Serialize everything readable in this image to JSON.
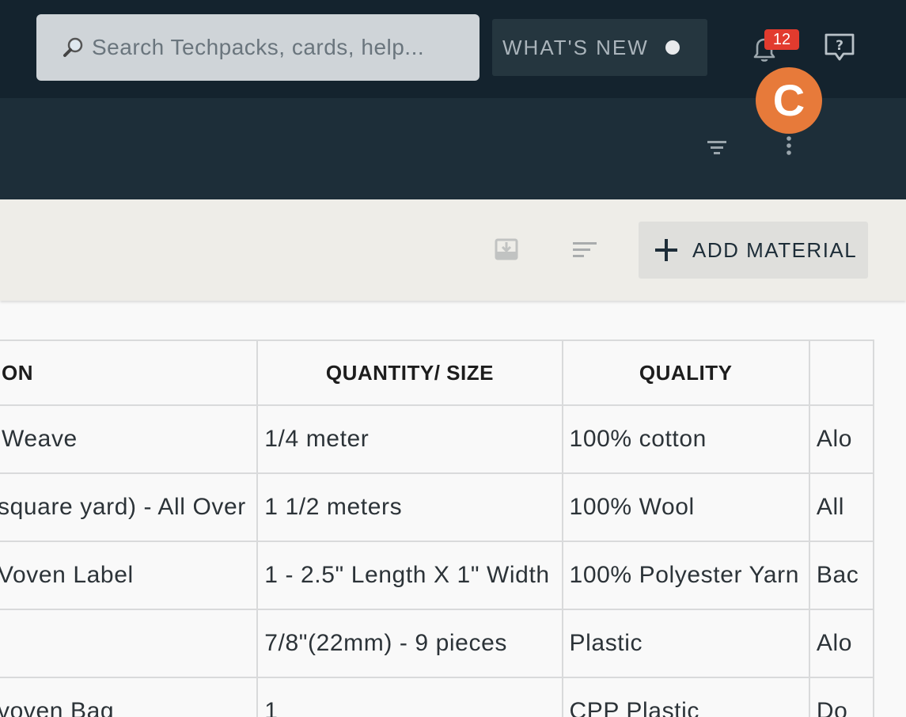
{
  "header": {
    "search": {
      "placeholder": "Search Techpacks, cards, help..."
    },
    "whats_new_label": "WHAT'S NEW",
    "notifications_count": "12",
    "avatar_initial": "C"
  },
  "toolbar": {
    "add_material_label": "ADD MATERIAL"
  },
  "materials_table": {
    "columns": [
      "ON",
      "QUANTITY/ SIZE",
      "QUALITY",
      ""
    ],
    "rows": [
      {
        "description": "Weave",
        "quantity": "1/4 meter",
        "quality": "100% cotton",
        "placement": "Alo"
      },
      {
        "description": "square yard) - All Over",
        "quantity": "1 1/2 meters",
        "quality": "100% Wool",
        "placement": "All"
      },
      {
        "description": "Voven Label",
        "quantity": "1 - 2.5\" Length X 1\" Width",
        "quality": "100% Polyester Yarn",
        "placement": "Bac"
      },
      {
        "description": "",
        "quantity": "7/8\"(22mm) - 9 pieces",
        "quality": "Plastic",
        "placement": "Alo"
      },
      {
        "description": "voven Bag",
        "quantity": "1",
        "quality": "CPP Plastic",
        "placement": "Do"
      }
    ]
  },
  "colors": {
    "topbar": "#14232e",
    "subbar": "#1d2e39",
    "avatar": "#e77a3a",
    "badge": "#e23b2e",
    "toolbar": "#eeede8"
  }
}
